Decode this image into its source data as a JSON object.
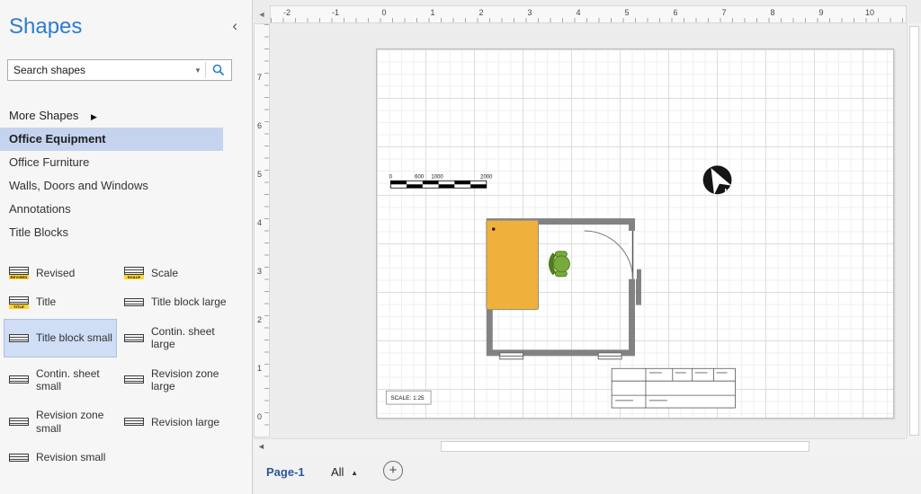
{
  "sidebar": {
    "title": "Shapes",
    "search": {
      "placeholder": "Search shapes"
    },
    "more_shapes_label": "More Shapes",
    "stencils": [
      {
        "label": "Office Equipment",
        "active": true
      },
      {
        "label": "Office Furniture"
      },
      {
        "label": "Walls, Doors and Windows"
      },
      {
        "label": "Annotations"
      },
      {
        "label": "Title Blocks"
      }
    ],
    "shapes": [
      {
        "label": "Revised",
        "caption": "REVISED"
      },
      {
        "label": "Scale",
        "caption": "SCALE"
      },
      {
        "label": "Title",
        "caption": "TITLE"
      },
      {
        "label": "Title block large"
      },
      {
        "label": "Title block small",
        "selected": true
      },
      {
        "label": "Contin. sheet large"
      },
      {
        "label": "Contin. sheet small"
      },
      {
        "label": "Revision zone large"
      },
      {
        "label": "Revision zone small"
      },
      {
        "label": "Revision large"
      },
      {
        "label": "Revision small"
      }
    ]
  },
  "rulers": {
    "horizontal": [
      "-2",
      "-1",
      "0",
      "1",
      "2",
      "3",
      "4",
      "5",
      "6",
      "7",
      "8",
      "9",
      "10"
    ],
    "vertical": [
      "7",
      "6",
      "5",
      "4",
      "3",
      "2",
      "1",
      "0"
    ]
  },
  "drawing": {
    "scale_note": "SCALE: 1:25",
    "scalebar": {
      "labels": [
        "0",
        "600",
        "1000",
        "2000"
      ]
    },
    "north": "N"
  },
  "pagebar": {
    "page_tab": "Page-1",
    "all_label": "All"
  },
  "icons": {
    "collapse": "‹",
    "more_arrow": "▶",
    "search_caret": "▼",
    "scroll_left": "◄",
    "all_marker": "▲",
    "add": "+"
  },
  "colors": {
    "accent": "#2b7cd3",
    "pagetab": "#2b579a",
    "desk": "#f0b03c",
    "chair": "#76ab3c",
    "wall": "#828282",
    "selection": "#cfddf5",
    "active_stencil_bg": "#c5d3ee"
  }
}
